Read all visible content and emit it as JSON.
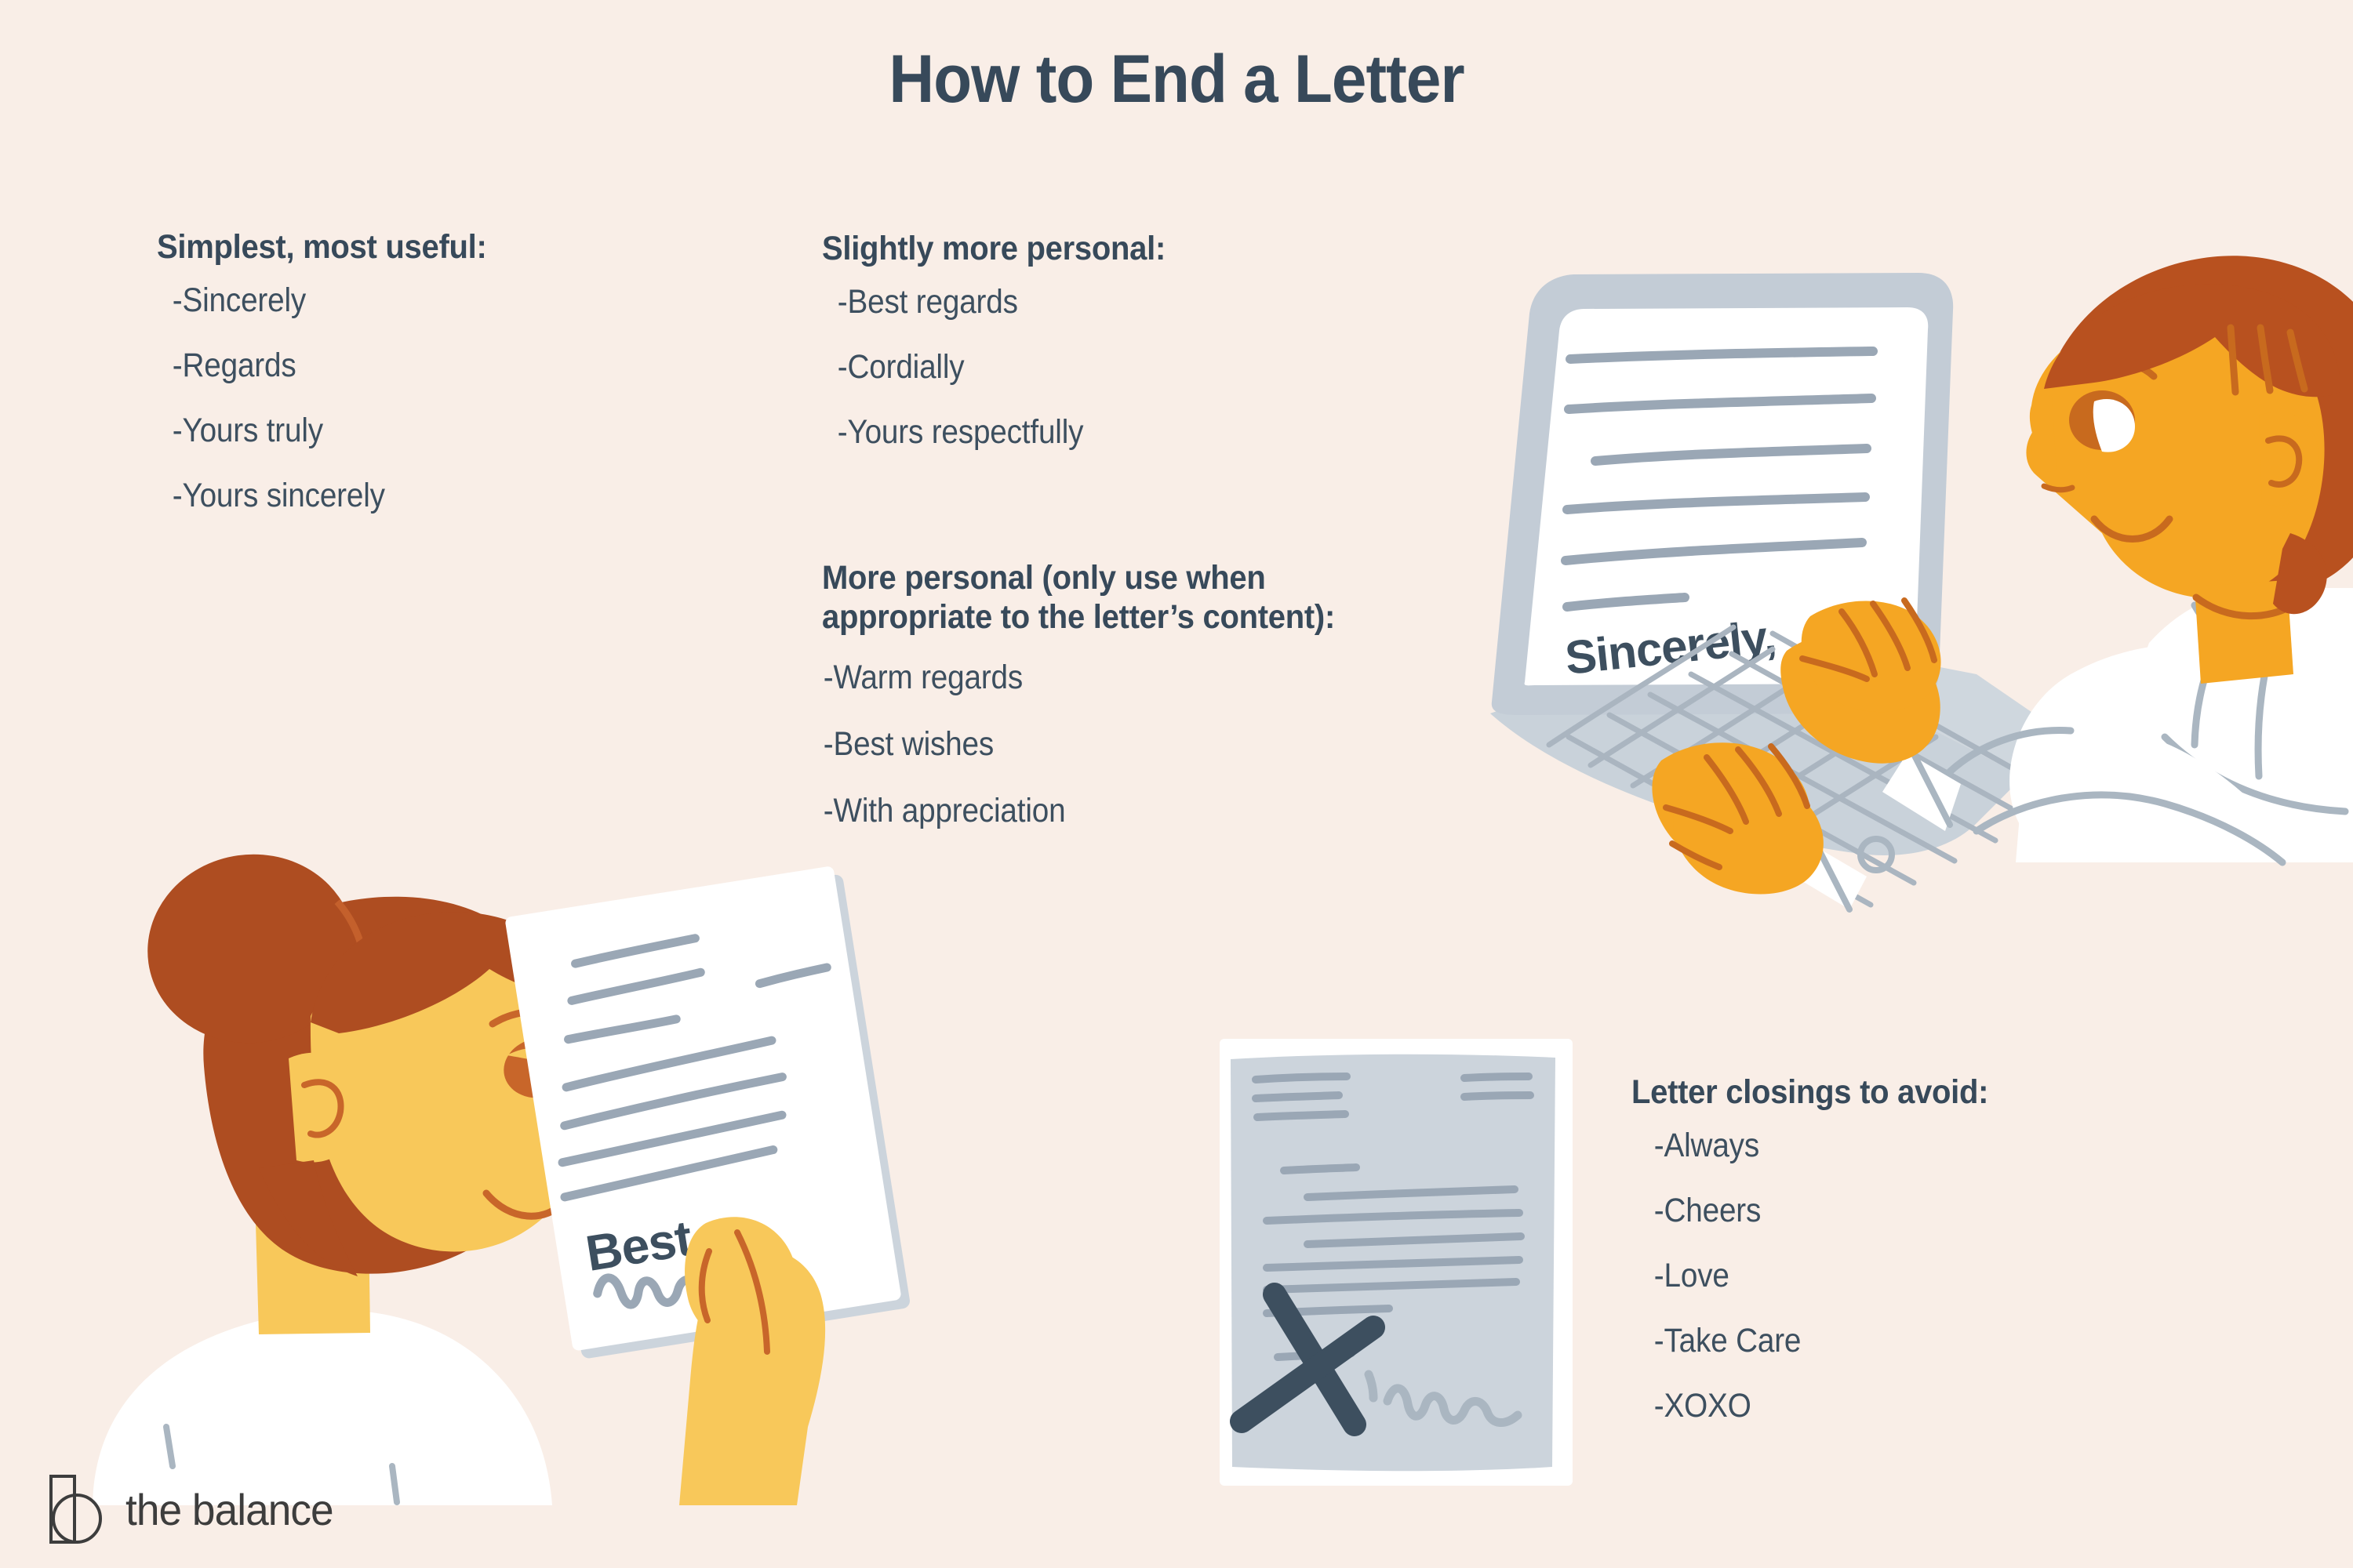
{
  "page": {
    "title": "How to End a Letter",
    "background_color": "#f9eee7",
    "text_color": "#37495a"
  },
  "sections": {
    "simplest": {
      "heading": "Simplest, most useful:",
      "items": [
        "-Sincerely",
        "-Regards",
        "-Yours truly",
        "-Yours sincerely"
      ]
    },
    "slightly_personal": {
      "heading": "Slightly more personal:",
      "items": [
        "-Best regards",
        "-Cordially",
        "-Yours respectfully"
      ]
    },
    "more_personal": {
      "heading": "More personal (only use when appropriate to the letter’s content):",
      "items": [
        "-Warm regards",
        "-Best wishes",
        "-With appreciation"
      ]
    },
    "avoid": {
      "heading": "Letter closings to avoid:",
      "items": [
        "-Always",
        "-Cheers",
        "-Love",
        "-Take Care",
        "-XOXO"
      ]
    }
  },
  "illustrations": {
    "laptop_man": {
      "name": "man-typing-on-laptop",
      "screen_closing": "Sincerely,",
      "screen_text_lines": 6,
      "skin_color": "#F5A623",
      "hair_color": "#B8511F",
      "shirt_color": "#ffffff",
      "laptop_color": "#c3ccd6"
    },
    "woman_letter": {
      "name": "woman-holding-letter",
      "letter_closing": "Best,",
      "has_signature_squiggle": true,
      "skin_color": "#F8C85A",
      "hair_color": "#AE4D21",
      "shirt_color": "#ffffff",
      "paper_color": "#ffffff"
    },
    "bad_letter": {
      "name": "rejected-letter-with-x",
      "mark": "X",
      "has_signature_squiggle": true,
      "paper_color": "#ccd4dc",
      "mark_color": "#3d4f5f"
    }
  },
  "brand": {
    "logo_text": "the balance",
    "logo_mark": "balance-logo-mark",
    "logo_color": "#3d3d3d"
  }
}
